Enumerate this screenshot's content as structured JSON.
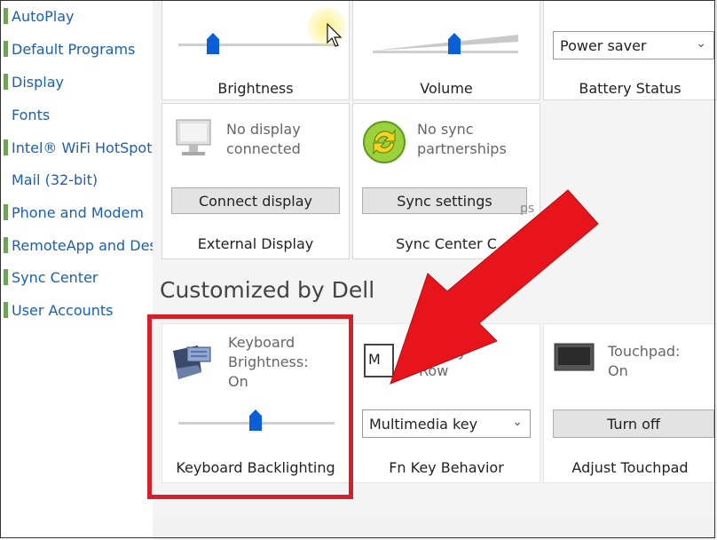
{
  "sidebar": {
    "items": [
      {
        "label": "AutoPlay"
      },
      {
        "label": "Default Programs"
      },
      {
        "label": "Display"
      },
      {
        "label": "Fonts"
      },
      {
        "label": "Intel® WiFi HotSpot"
      },
      {
        "label": "Mail (32-bit)"
      },
      {
        "label": "Phone and Modem"
      },
      {
        "label": "RemoteApp and Des"
      },
      {
        "label": "Sync Center"
      },
      {
        "label": "User Accounts"
      }
    ]
  },
  "tiles": {
    "brightness": {
      "caption": "Brightness",
      "level": 0.2
    },
    "volume": {
      "caption": "Volume",
      "level": 0.55
    },
    "battery": {
      "caption": "Battery Status",
      "selected": "Power saver"
    },
    "external_display": {
      "status": "No display\nconnected",
      "button": "Connect display",
      "caption": "External Display"
    },
    "sync_center": {
      "status": "No sync\npartnerships",
      "button": "Sync settings",
      "caption": "Sync Center C",
      "overflow": "ps"
    }
  },
  "section": {
    "title": "Customized by Dell"
  },
  "dell_tiles": {
    "keyboard": {
      "status": "Keyboard\nBrightness:\nOn",
      "caption": "Keyboard Backlighting",
      "level": 0.5
    },
    "fn_key": {
      "status": "Fn Key\nRow",
      "icon_label": "M",
      "selected": "Multimedia key",
      "caption": "Fn Key Behavior"
    },
    "touchpad": {
      "status": "Touchpad:\nOn",
      "button": "Turn off",
      "caption": "Adjust Touchpad"
    }
  },
  "colors": {
    "highlight": "#d4202a",
    "arrow": "#e8141b",
    "slider": "#0a5fd6",
    "link": "#1a5fb4"
  }
}
